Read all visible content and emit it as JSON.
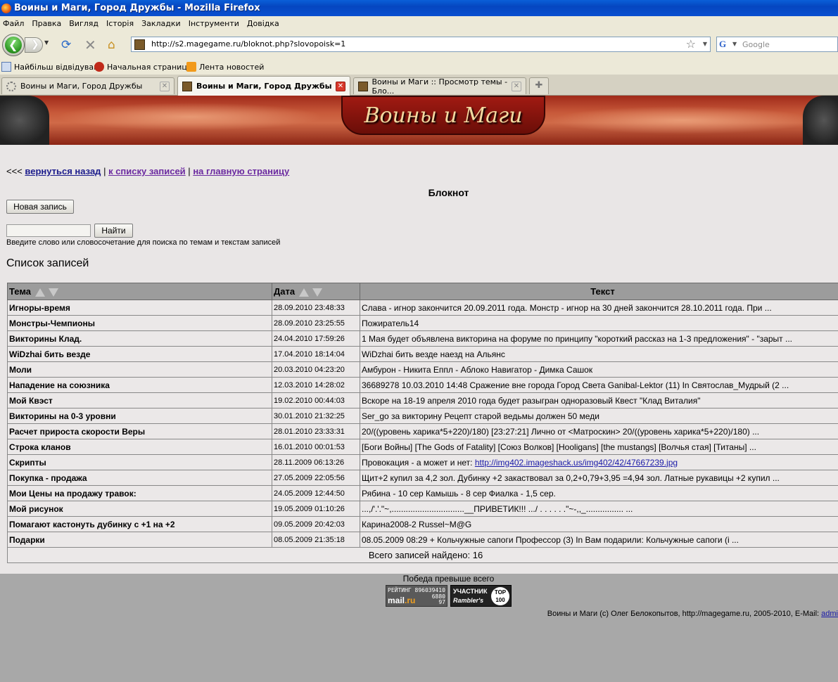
{
  "window": {
    "title": "Воины и Маги, Город Дружбы - Mozilla Firefox"
  },
  "menu": [
    "Файл",
    "Правка",
    "Вигляд",
    "Історія",
    "Закладки",
    "Інструменти",
    "Довідка"
  ],
  "nav": {
    "url": "http://s2.magegame.ru/bloknot.php?slovopoisk=1",
    "search_placeholder": "Google"
  },
  "bookmarks": [
    "Найбільш відвідувані",
    "Начальная страница",
    "Лента новостей"
  ],
  "tabs": [
    {
      "label": "Воины и Маги, Город Дружбы",
      "active": false
    },
    {
      "label": "Воины и Маги, Город Дружбы",
      "active": true
    },
    {
      "label": "Воины и Маги :: Просмотр темы - Бло...",
      "active": false
    }
  ],
  "page": {
    "logo": "Воины и Маги",
    "nav_prefix": "<<<",
    "link_back": "вернуться назад",
    "link_list": "к списку записей",
    "link_home": "на главную страницу",
    "sep": "|",
    "title": "Блокнот",
    "new_record_button": "Новая запись",
    "search_value": "",
    "search_button": "Найти",
    "search_hint": "Введите слово или словосочетание для поиска по темам и текстам записей",
    "list_title": "Список записей",
    "columns": {
      "topic": "Тема",
      "date": "Дата",
      "text": "Текст"
    },
    "rows": [
      {
        "topic": "Игноры-время",
        "date": "28.09.2010 23:48:33",
        "text": "Слава - игнор закончится 20.09.2011 года. Монстр - игнор на 30 дней закончится 28.10.2011 года. При ..."
      },
      {
        "topic": "Монстры-Чемпионы",
        "date": "28.09.2010 23:25:55",
        "text": "Пожиратель14"
      },
      {
        "topic": "Викторины Клад.",
        "date": "24.04.2010 17:59:26",
        "text": "1 Мая будет объявлена викторина на форуме по принципу \"короткий рассказ на 1-3 предложения\" - \"зарыт ..."
      },
      {
        "topic": "WiDzhai бить везде",
        "date": "17.04.2010 18:14:04",
        "text": "WiDzhai бить везде наезд на Альянс"
      },
      {
        "topic": "Моли",
        "date": "20.03.2010 04:23:20",
        "text": "Амбурон - Никита Еппл - Аблоко Навигатор - Димка Сашок"
      },
      {
        "topic": "Нападение на союзника",
        "date": "12.03.2010 14:28:02",
        "text": "36689278 10.03.2010 14:48 Сражение вне города Город Света Ganibal-Lektor (11) In Святослав_Мудрый (2 ..."
      },
      {
        "topic": "Мой Квэст",
        "date": "19.02.2010 00:44:03",
        "text": "Вскоре на 18-19 апреля 2010 года будет разыгран одноразовый Квест \"Клад Виталия\""
      },
      {
        "topic": "Викторины на 0-3 уровни",
        "date": "30.01.2010 21:32:25",
        "text": "Ser_go за викторину Рецепт старой ведьмы должен 50 меди"
      },
      {
        "topic": "Расчет прироста скорости Веры",
        "date": "28.01.2010 23:33:31",
        "text": "20/((уровень харика*5+220)/180) [23:27:21] Лично от <Матроскин> 20/((уровень харика*5+220)/180) ..."
      },
      {
        "topic": "Строка кланов",
        "date": "16.01.2010 00:01:53",
        "text": "[Боги Войны] [The Gods of Fatality] [Союз Волков] [Hooligans] [the mustangs] [Волчья стая] [Титаны] ..."
      },
      {
        "topic": "Скрипты",
        "date": "28.11.2009 06:13:26",
        "text": "Провокация - а может и нет: ",
        "link": "http://img402.imageshack.us/img402/42/47667239.jpg"
      },
      {
        "topic": "Покупка - продажа",
        "date": "27.05.2009 22:05:56",
        "text": "Щит+2 купил за 4,2 зол. Дубинку +2 закаствовал за 0,2+0,79+3,95 =4,94 зол. Латные рукавицы +2 купил ..."
      },
      {
        "topic": "Мои Цены на продажу травок:",
        "date": "24.05.2009 12:44:50",
        "text": "Рябина - 10 сер Камышь - 8 сер Фиалка - 1,5 сер."
      },
      {
        "topic": "Мой рисунок",
        "date": "19.05.2009 01:10:26",
        "text": "...,/'.'.\"~,...............................__ПРИВЕТИК!!! .../ . . . . . .\"~-,,_................ ..."
      },
      {
        "topic": "Помагают кастонуть дубинку с +1 на +2",
        "date": "09.05.2009 20:42:03",
        "text": "Карина2008-2 Russel~M@G"
      },
      {
        "topic": "Подарки",
        "date": "08.05.2009 21:35:18",
        "text": "08.05.2009 08:29 + Кольчужные сапоги Профессор           (3) In Вам подарили: Кольчужные сапоги (i ..."
      }
    ],
    "total": "Всего записей найдено: 16",
    "motto": "Победа превыше всего",
    "counter_mail": {
      "l1": "РЕЙТИНГ 896039410",
      "brand1": "mail",
      "brand2": ".ru",
      "n1": "6880",
      "n2": "97"
    },
    "counter_rambler": {
      "a": "УЧАСТНИК",
      "b": "Rambler's",
      "c": "TOP 100"
    },
    "copyright": "Воины и Маги (c) Олег Белокопытов, http://magegame.ru, 2005-2010, E-Mail: ",
    "copyright_link": "admi"
  }
}
